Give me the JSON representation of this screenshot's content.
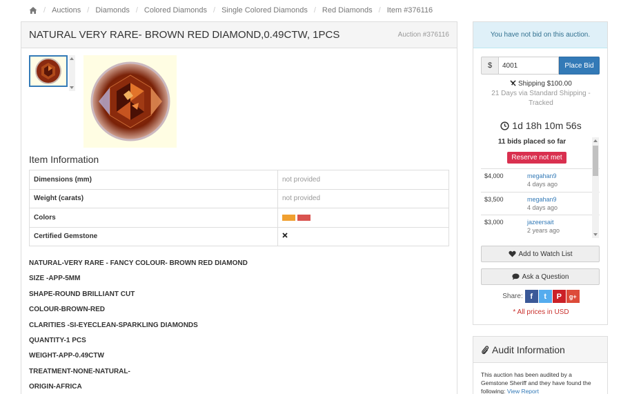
{
  "breadcrumb": {
    "items": [
      "Auctions",
      "Diamonds",
      "Colored Diamonds",
      "Single Colored Diamonds",
      "Red Diamonds",
      "Item #376116"
    ]
  },
  "listing": {
    "title": "NATURAL VERY RARE- BROWN RED DIAMOND,0.49CTW, 1PCS",
    "auction_number": "Auction #376116",
    "section_title": "Item Information",
    "info_rows": [
      {
        "label": "Dimensions (mm)",
        "value": "not provided"
      },
      {
        "label": "Weight (carats)",
        "value": "not provided"
      },
      {
        "label": "Colors",
        "value": ""
      },
      {
        "label": "Certified Gemstone",
        "value": ""
      }
    ],
    "color_swatches": [
      "#f0a030",
      "#d9534f"
    ],
    "certified_icon": "cross-icon",
    "description": [
      "NATURAL-VERY RARE - FANCY COLOUR- BROWN RED DIAMOND",
      "SIZE -APP-5MM",
      "SHAPE-ROUND BRILLIANT CUT",
      "COLOUR-BROWN-RED",
      "CLARITIES -SI-EYECLEAN-SPARKLING DIAMONDS",
      "QUANTITY-1 PCS",
      "WEIGHT-APP-0.49CTW",
      "TREATMENT-NONE-NATURAL-",
      "ORIGIN-AFRICA"
    ]
  },
  "bid": {
    "status": "You have not bid on this auction.",
    "currency_symbol": "$",
    "amount": "4001",
    "place_label": "Place Bid",
    "shipping_cost": "Shipping $100.00",
    "shipping_method": "21 Days via Standard Shipping - Tracked",
    "time_left": "1d 18h 10m 56s",
    "bids_count": "11 bids placed so far",
    "reserve": "Reserve not met",
    "history": [
      {
        "amount": "$4,000",
        "user": "megahan9",
        "time": "4 days ago"
      },
      {
        "amount": "$3,500",
        "user": "megahan9",
        "time": "4 days ago"
      },
      {
        "amount": "$3,000",
        "user": "jazeersait",
        "time": "2 years ago"
      }
    ],
    "watch_label": "Add to Watch List",
    "ask_label": "Ask a Question",
    "share_label": "Share:",
    "social": [
      "f",
      "t",
      "P",
      "g+"
    ],
    "prices_note": "* All prices in USD"
  },
  "audit": {
    "title": "Audit Information",
    "body": "This auction has been audited by a Gemstone Sheriff and they have found the following:",
    "link": "View Report"
  }
}
